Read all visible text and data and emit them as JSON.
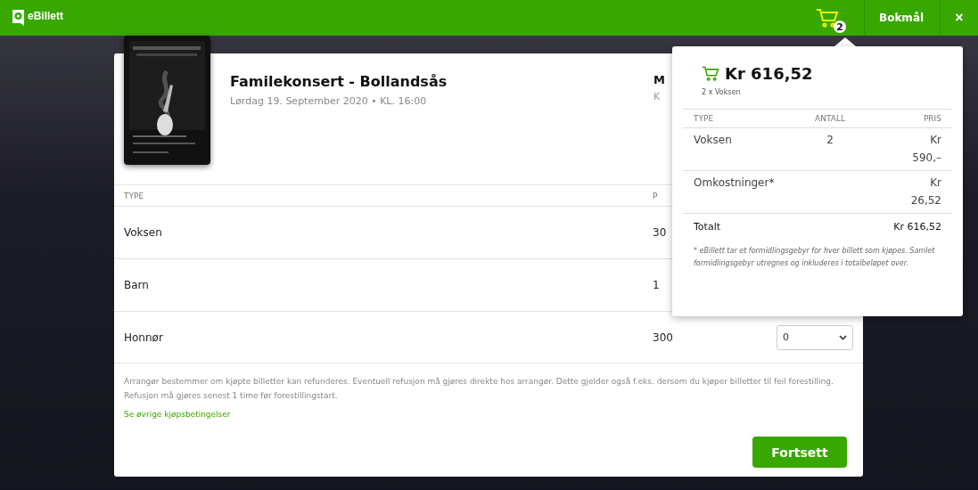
{
  "header": {
    "logo_text": "eBillett",
    "cart_count": "2",
    "language": "Bokmål",
    "close": "×"
  },
  "event": {
    "title": "Familekonsert - Bollandsås",
    "date": "Lørdag 19. September 2020 • KL. 16:00",
    "side_lines": [
      "M",
      "K"
    ]
  },
  "tickets": {
    "columns": [
      "TYPE",
      "P"
    ],
    "rows": [
      {
        "type": "Voksen",
        "price": "30"
      },
      {
        "type": "Barn",
        "price": "1"
      },
      {
        "type": "Honnør",
        "price": "300",
        "quantity": "0"
      }
    ]
  },
  "terms": "Arrangør bestemmer om kjøpte billetter kan refunderes. Eventuell refusjon må gjøres direkte hos arrangør. Dette gjelder også f.eks. dersom du kjøper billetter til feil forestilling. Refusjon må gjøres senest 1 time før forestillingstart.",
  "terms_link": "Se øvrige kjøpsbetingelser",
  "continue_button": "Fortsett",
  "cart_popup": {
    "total": "Kr 616,52",
    "summary": "2 x Voksen",
    "columns": [
      "TYPE",
      "ANTALL",
      "PRIS"
    ],
    "rows": [
      {
        "type": "Voksen",
        "quantity": "2",
        "price": "Kr 590,–"
      },
      {
        "type": "Omkostninger*",
        "price": "Kr 26,52"
      }
    ],
    "total_label": "Totalt",
    "total_value": "Kr 616,52",
    "footnote": "* eBillett tar et formidlingsgebyr for hver billett som kjøpes. Samlet formidlingsgebyr utregnes og inkluderes i totalbeløpet over."
  }
}
